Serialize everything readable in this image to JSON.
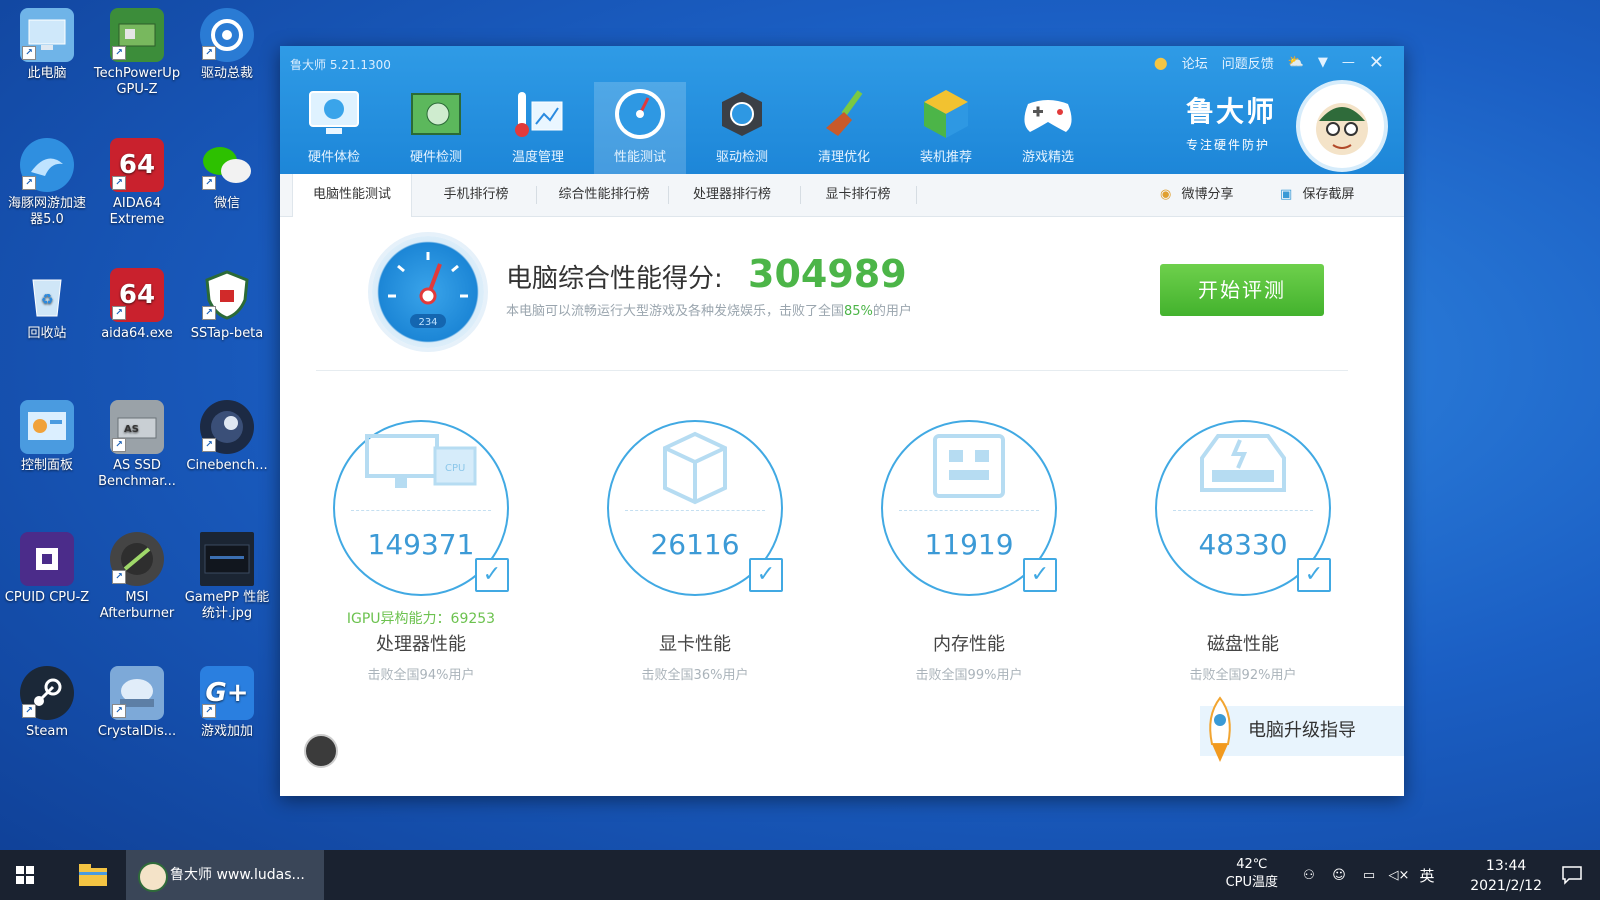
{
  "desktop": {
    "icons": [
      {
        "label": "此电脑",
        "icon": "computer-icon",
        "color": "#6fb4e8"
      },
      {
        "label": "TechPowerUp GPU-Z",
        "icon": "gpu-z-icon",
        "color": "#3c8d3a"
      },
      {
        "label": "驱动总裁",
        "icon": "driver-icon",
        "color": "#2a7bd4"
      },
      {
        "label": "海豚网游加速器5.0",
        "icon": "dolphin-icon",
        "color": "#2f8fe0"
      },
      {
        "label": "AIDA64 Extreme",
        "icon": "aida64-icon",
        "color": "#c9212d"
      },
      {
        "label": "微信",
        "icon": "wechat-icon",
        "color": "#2dc100"
      },
      {
        "label": "回收站",
        "icon": "recycle-bin-icon",
        "color": "#9ec9e8"
      },
      {
        "label": "aida64.exe",
        "icon": "aida64-icon",
        "color": "#c9212d"
      },
      {
        "label": "SSTap-beta",
        "icon": "shield-icon",
        "color": "#ffffff"
      },
      {
        "label": "控制面板",
        "icon": "control-panel-icon",
        "color": "#4a9be0"
      },
      {
        "label": "AS SSD Benchmar...",
        "icon": "ssd-icon",
        "color": "#9aa2a8"
      },
      {
        "label": "Cinebench...",
        "icon": "cinebench-icon",
        "color": "#1c2a44"
      },
      {
        "label": "CPUID CPU-Z",
        "icon": "cpu-z-icon",
        "color": "#4b2c8a"
      },
      {
        "label": "MSI Afterburner",
        "icon": "afterburner-icon",
        "color": "#444444"
      },
      {
        "label": "GamePP 性能统计.jpg",
        "icon": "image-file-icon",
        "color": "#1b2533"
      },
      {
        "label": "Steam",
        "icon": "steam-icon",
        "color": "#1b2838"
      },
      {
        "label": "CrystalDis...",
        "icon": "crystaldisk-icon",
        "color": "#7da9d8"
      },
      {
        "label": "游戏加加",
        "icon": "game-plus-icon",
        "color": "#2a7fe0"
      }
    ]
  },
  "app": {
    "title": "鲁大师 5.21.1300",
    "titlebar_links": [
      "论坛",
      "问题反馈"
    ],
    "toolbar": [
      {
        "label": "硬件体检",
        "icon": "monitor-check-icon"
      },
      {
        "label": "硬件检测",
        "icon": "motherboard-icon"
      },
      {
        "label": "温度管理",
        "icon": "thermometer-icon"
      },
      {
        "label": "性能测试",
        "icon": "speedometer-icon"
      },
      {
        "label": "驱动检测",
        "icon": "gear-driver-icon"
      },
      {
        "label": "清理优化",
        "icon": "broom-icon"
      },
      {
        "label": "装机推荐",
        "icon": "cube-icon"
      },
      {
        "label": "游戏精选",
        "icon": "gamepad-icon"
      }
    ],
    "brand": {
      "name": "鲁大师",
      "tagline": "专注硬件防护"
    },
    "tabs": [
      "电脑性能测试",
      "手机排行榜",
      "综合性能排行榜",
      "处理器排行榜",
      "显卡排行榜"
    ],
    "share": {
      "weibo": "微博分享",
      "screenshot": "保存截屏"
    },
    "score": {
      "title": "电脑综合性能得分:",
      "value": "304989",
      "desc_prefix": "本电脑可以流畅运行大型游戏及各种发烧娱乐，击败了全国",
      "desc_pct": "85%",
      "desc_suffix": "的用户",
      "start_button": "开始评测",
      "gauge_readout": "234"
    },
    "cards": [
      {
        "value": "149371",
        "extra": "IGPU异构能力：69253",
        "label": "处理器性能",
        "sub": "击败全国94%用户",
        "icon": "cpu-monitor-icon",
        "checked": true
      },
      {
        "value": "26116",
        "extra": "",
        "label": "显卡性能",
        "sub": "击败全国36%用户",
        "icon": "gpu-cube-icon",
        "checked": true
      },
      {
        "value": "11919",
        "extra": "",
        "label": "内存性能",
        "sub": "击败全国99%用户",
        "icon": "ram-chip-icon",
        "checked": true
      },
      {
        "value": "48330",
        "extra": "",
        "label": "磁盘性能",
        "sub": "击败全国92%用户",
        "icon": "disk-drive-icon",
        "checked": true
      }
    ],
    "upgrade_guide": "电脑升级指导"
  },
  "taskbar": {
    "active_app": "鲁大师 www.ludas...",
    "cpu_temp_value": "42℃",
    "cpu_temp_label": "CPU温度",
    "ime": "英",
    "time": "13:44",
    "date": "2021/2/12"
  },
  "colors": {
    "accent": "#1d86d8",
    "score_green": "#4cb548",
    "ring_blue": "#41a9e3"
  }
}
